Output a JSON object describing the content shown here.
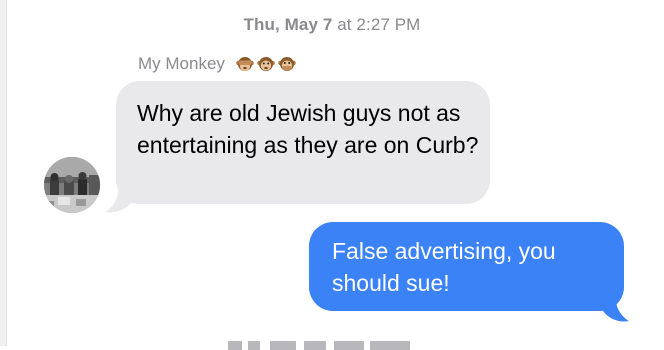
{
  "conversation": {
    "timestamp_day": "Thu, May 7",
    "timestamp_time": "at 2:27 PM",
    "sender": {
      "name": "My Monkey",
      "name_emojis": [
        "see-no-evil-monkey-icon",
        "monkey-face-icon",
        "speak-no-evil-monkey-icon"
      ]
    },
    "messages": [
      {
        "direction": "incoming",
        "text": "Why are old Jewish guys not as entertaining as they are on Curb?"
      },
      {
        "direction": "outgoing",
        "text": "False advertising, you should sue!"
      }
    ]
  },
  "colors": {
    "incoming_bubble": "#e9e9eb",
    "outgoing_bubble": "#3b82f7",
    "meta_text": "#8a8a8e"
  }
}
